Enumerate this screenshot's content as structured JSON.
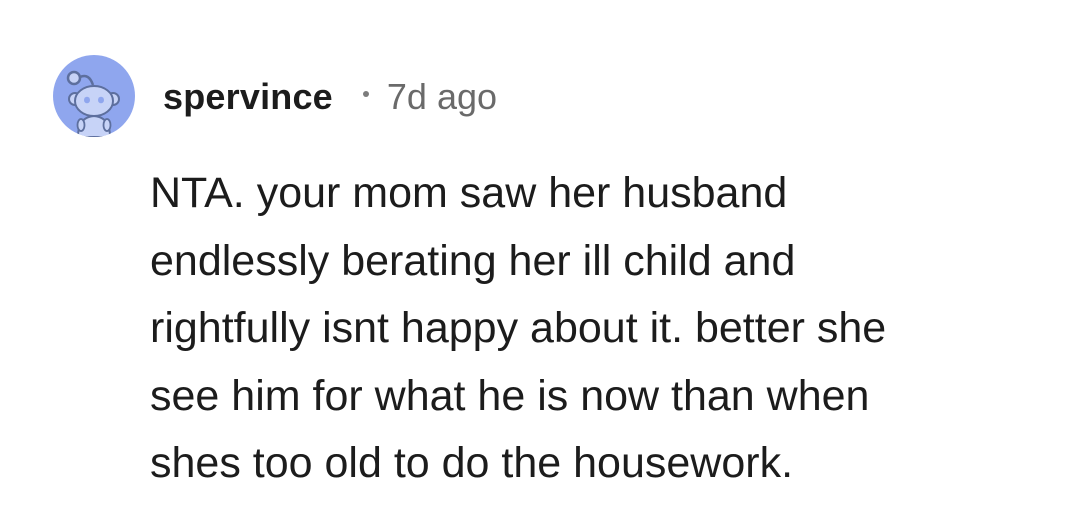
{
  "comment": {
    "author": "spervince",
    "separator_icon": "dot-separator-icon",
    "timestamp": "7d ago",
    "avatar_icon": "snoo-avatar-icon",
    "lines": [
      "NTA. your mom saw her husband",
      "endlessly berating her ill child and",
      "rightfully isnt happy about it. better she",
      "see him for what he is now than when",
      "shes too old to do the housework."
    ]
  },
  "colors": {
    "avatar_background": "#8fa6ee",
    "username": "#1c1c1c",
    "timestamp": "#6a6a6a",
    "body": "#1c1c1c"
  }
}
